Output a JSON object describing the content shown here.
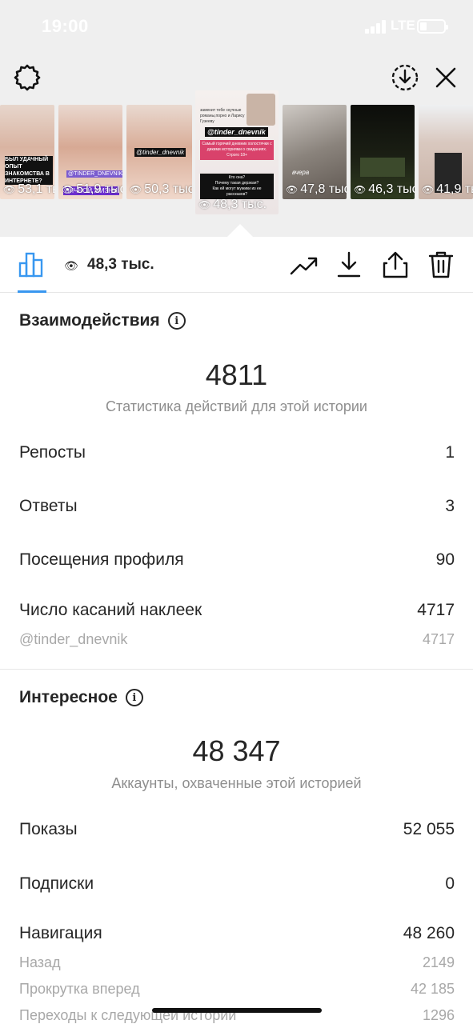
{
  "status_bar": {
    "time": "19:00",
    "network": "LTE"
  },
  "stories": [
    {
      "views": "53,1 тыс.",
      "overlay": [
        "БЫЛ УДАЧНЫЙ ОПЫТ ЗНАКОМСТВА В ИНТЕРНЕТЕ?",
        "ДА",
        "НЕТ"
      ]
    },
    {
      "views": "51,9 тыс.",
      "overlay": [
        "@TINDER_DNEVNIK",
        "ЛИЧНОЙ ЖИЗНИ"
      ]
    },
    {
      "views": "50,3 тыс.",
      "overlay": [
        "@tinder_dnevnik"
      ]
    },
    {
      "views": "48,3 тыс.",
      "overlay": [
        "заменит тебе скучные романы,порно и Ларису Гузееву",
        "@tinder_dnevnik",
        "Самый горячий дневник холостячки с дикими историями о свиданиях. Строго 18+",
        "Кто она?",
        "Почему такая дерзкая?",
        "Как ей могут мужики из ее рассказов?"
      ]
    },
    {
      "views": "47,8 тыс.",
      "overlay": [
        "вчера"
      ]
    },
    {
      "views": "46,3 тыс.",
      "overlay": []
    },
    {
      "views": "41,9 тыс.",
      "overlay": []
    }
  ],
  "toolbar": {
    "views": "48,3 тыс."
  },
  "interactions": {
    "title": "Взаимодействия",
    "total": "4811",
    "caption": "Статистика действий для этой истории",
    "rows": [
      {
        "label": "Репосты",
        "value": "1"
      },
      {
        "label": "Ответы",
        "value": "3"
      },
      {
        "label": "Посещения профиля",
        "value": "90"
      },
      {
        "label": "Число касаний наклеек",
        "value": "4717"
      }
    ],
    "sub_rows": [
      {
        "label": "@tinder_dnevnik",
        "value": "4717"
      }
    ]
  },
  "discovery": {
    "title": "Интересное",
    "total": "48 347",
    "caption": "Аккаунты, охваченные этой историей",
    "rows": [
      {
        "label": "Показы",
        "value": "52 055"
      },
      {
        "label": "Подписки",
        "value": "0"
      },
      {
        "label": "Навигация",
        "value": "48 260"
      }
    ],
    "sub_rows": [
      {
        "label": "Назад",
        "value": "2149"
      },
      {
        "label": "Прокрутка вперед",
        "value": "42 185"
      },
      {
        "label": "Переходы к следующей истории",
        "value": "1296"
      }
    ]
  },
  "colors": {
    "accent": "#3897f0",
    "text": "#262626",
    "muted": "#8e8e8e",
    "sub_muted": "#a8a8a8",
    "header_bg": "#efefef"
  },
  "icons": {
    "settings": "gear-icon",
    "download_circle": "download-circle-icon",
    "close": "close-icon",
    "insights": "bar-chart-icon",
    "eye": "eye-icon",
    "promote": "trend-arrow-icon",
    "save": "download-icon",
    "share": "share-icon",
    "delete": "trash-icon",
    "info": "info-icon"
  }
}
